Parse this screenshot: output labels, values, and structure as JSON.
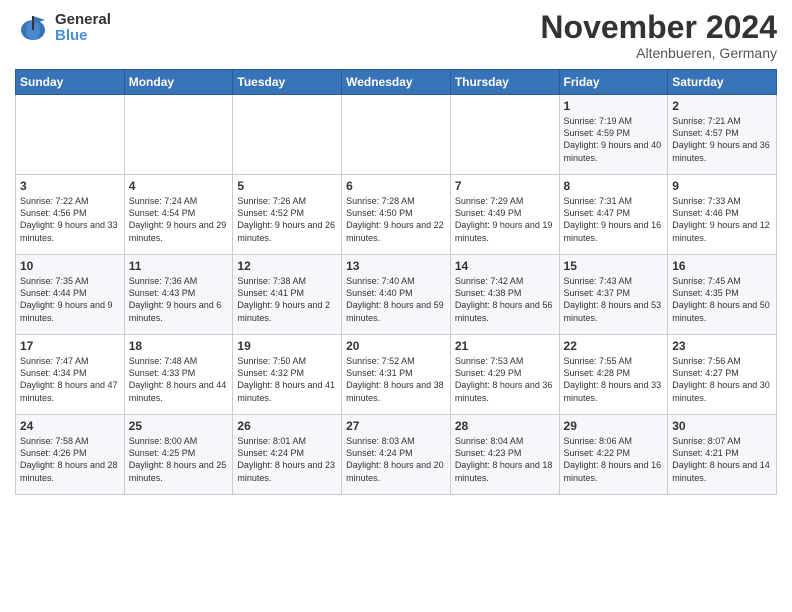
{
  "logo": {
    "line1": "General",
    "line2": "Blue"
  },
  "title": "November 2024",
  "location": "Altenbueren, Germany",
  "days_of_week": [
    "Sunday",
    "Monday",
    "Tuesday",
    "Wednesday",
    "Thursday",
    "Friday",
    "Saturday"
  ],
  "weeks": [
    [
      {
        "day": "",
        "info": ""
      },
      {
        "day": "",
        "info": ""
      },
      {
        "day": "",
        "info": ""
      },
      {
        "day": "",
        "info": ""
      },
      {
        "day": "",
        "info": ""
      },
      {
        "day": "1",
        "info": "Sunrise: 7:19 AM\nSunset: 4:59 PM\nDaylight: 9 hours\nand 40 minutes."
      },
      {
        "day": "2",
        "info": "Sunrise: 7:21 AM\nSunset: 4:57 PM\nDaylight: 9 hours\nand 36 minutes."
      }
    ],
    [
      {
        "day": "3",
        "info": "Sunrise: 7:22 AM\nSunset: 4:56 PM\nDaylight: 9 hours\nand 33 minutes."
      },
      {
        "day": "4",
        "info": "Sunrise: 7:24 AM\nSunset: 4:54 PM\nDaylight: 9 hours\nand 29 minutes."
      },
      {
        "day": "5",
        "info": "Sunrise: 7:26 AM\nSunset: 4:52 PM\nDaylight: 9 hours\nand 26 minutes."
      },
      {
        "day": "6",
        "info": "Sunrise: 7:28 AM\nSunset: 4:50 PM\nDaylight: 9 hours\nand 22 minutes."
      },
      {
        "day": "7",
        "info": "Sunrise: 7:29 AM\nSunset: 4:49 PM\nDaylight: 9 hours\nand 19 minutes."
      },
      {
        "day": "8",
        "info": "Sunrise: 7:31 AM\nSunset: 4:47 PM\nDaylight: 9 hours\nand 16 minutes."
      },
      {
        "day": "9",
        "info": "Sunrise: 7:33 AM\nSunset: 4:46 PM\nDaylight: 9 hours\nand 12 minutes."
      }
    ],
    [
      {
        "day": "10",
        "info": "Sunrise: 7:35 AM\nSunset: 4:44 PM\nDaylight: 9 hours\nand 9 minutes."
      },
      {
        "day": "11",
        "info": "Sunrise: 7:36 AM\nSunset: 4:43 PM\nDaylight: 9 hours\nand 6 minutes."
      },
      {
        "day": "12",
        "info": "Sunrise: 7:38 AM\nSunset: 4:41 PM\nDaylight: 9 hours\nand 2 minutes."
      },
      {
        "day": "13",
        "info": "Sunrise: 7:40 AM\nSunset: 4:40 PM\nDaylight: 8 hours\nand 59 minutes."
      },
      {
        "day": "14",
        "info": "Sunrise: 7:42 AM\nSunset: 4:38 PM\nDaylight: 8 hours\nand 56 minutes."
      },
      {
        "day": "15",
        "info": "Sunrise: 7:43 AM\nSunset: 4:37 PM\nDaylight: 8 hours\nand 53 minutes."
      },
      {
        "day": "16",
        "info": "Sunrise: 7:45 AM\nSunset: 4:35 PM\nDaylight: 8 hours\nand 50 minutes."
      }
    ],
    [
      {
        "day": "17",
        "info": "Sunrise: 7:47 AM\nSunset: 4:34 PM\nDaylight: 8 hours\nand 47 minutes."
      },
      {
        "day": "18",
        "info": "Sunrise: 7:48 AM\nSunset: 4:33 PM\nDaylight: 8 hours\nand 44 minutes."
      },
      {
        "day": "19",
        "info": "Sunrise: 7:50 AM\nSunset: 4:32 PM\nDaylight: 8 hours\nand 41 minutes."
      },
      {
        "day": "20",
        "info": "Sunrise: 7:52 AM\nSunset: 4:31 PM\nDaylight: 8 hours\nand 38 minutes."
      },
      {
        "day": "21",
        "info": "Sunrise: 7:53 AM\nSunset: 4:29 PM\nDaylight: 8 hours\nand 36 minutes."
      },
      {
        "day": "22",
        "info": "Sunrise: 7:55 AM\nSunset: 4:28 PM\nDaylight: 8 hours\nand 33 minutes."
      },
      {
        "day": "23",
        "info": "Sunrise: 7:56 AM\nSunset: 4:27 PM\nDaylight: 8 hours\nand 30 minutes."
      }
    ],
    [
      {
        "day": "24",
        "info": "Sunrise: 7:58 AM\nSunset: 4:26 PM\nDaylight: 8 hours\nand 28 minutes."
      },
      {
        "day": "25",
        "info": "Sunrise: 8:00 AM\nSunset: 4:25 PM\nDaylight: 8 hours\nand 25 minutes."
      },
      {
        "day": "26",
        "info": "Sunrise: 8:01 AM\nSunset: 4:24 PM\nDaylight: 8 hours\nand 23 minutes."
      },
      {
        "day": "27",
        "info": "Sunrise: 8:03 AM\nSunset: 4:24 PM\nDaylight: 8 hours\nand 20 minutes."
      },
      {
        "day": "28",
        "info": "Sunrise: 8:04 AM\nSunset: 4:23 PM\nDaylight: 8 hours\nand 18 minutes."
      },
      {
        "day": "29",
        "info": "Sunrise: 8:06 AM\nSunset: 4:22 PM\nDaylight: 8 hours\nand 16 minutes."
      },
      {
        "day": "30",
        "info": "Sunrise: 8:07 AM\nSunset: 4:21 PM\nDaylight: 8 hours\nand 14 minutes."
      }
    ]
  ]
}
